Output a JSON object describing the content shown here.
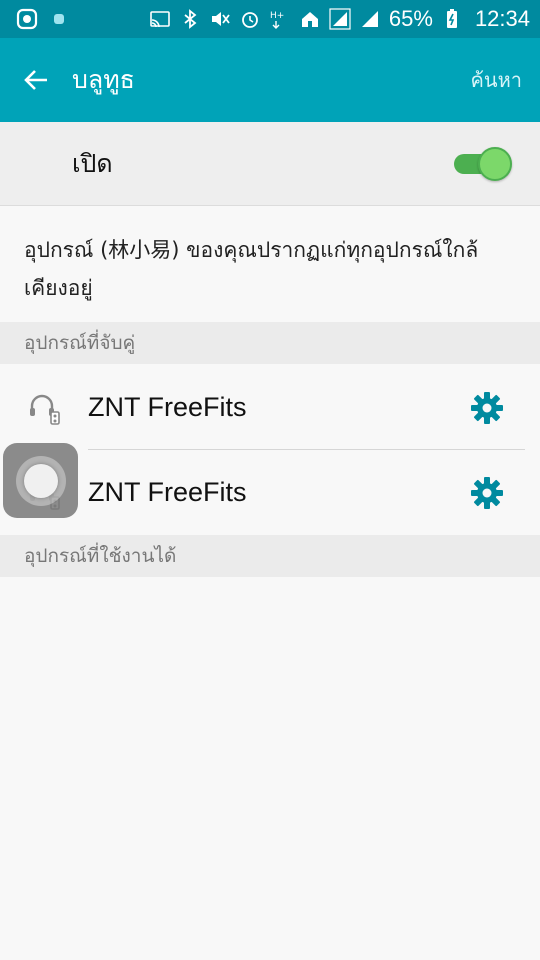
{
  "status_bar": {
    "battery": "65%",
    "time": "12:34",
    "icons": [
      "cast-icon",
      "bluetooth-icon",
      "mute-icon",
      "alarm-icon",
      "data-icon",
      "home-icon",
      "signal-icon",
      "signal-icon-2",
      "battery-charging-icon"
    ]
  },
  "app_bar": {
    "title": "บลูทูธ",
    "action_label": "ค้นหา"
  },
  "toggle": {
    "label": "เปิด",
    "state": true
  },
  "description": "อุปกรณ์ (林小易) ของคุณปรากฏแก่ทุกอุปกรณ์ใกล้เคียงอยู่",
  "paired": {
    "header": "อุปกรณ์ที่จับคู่",
    "devices": [
      {
        "name": "ZNT FreeFits",
        "icon": "headset-icon"
      },
      {
        "name": "ZNT FreeFits",
        "icon": "headset-icon"
      }
    ]
  },
  "available": {
    "header": "อุปกรณ์ที่ใช้งานได้"
  },
  "colors": {
    "status_bar": "#008a9f",
    "app_bar": "#00a3b8",
    "accent": "#00a3b8",
    "switch_on": "#4caf50"
  }
}
